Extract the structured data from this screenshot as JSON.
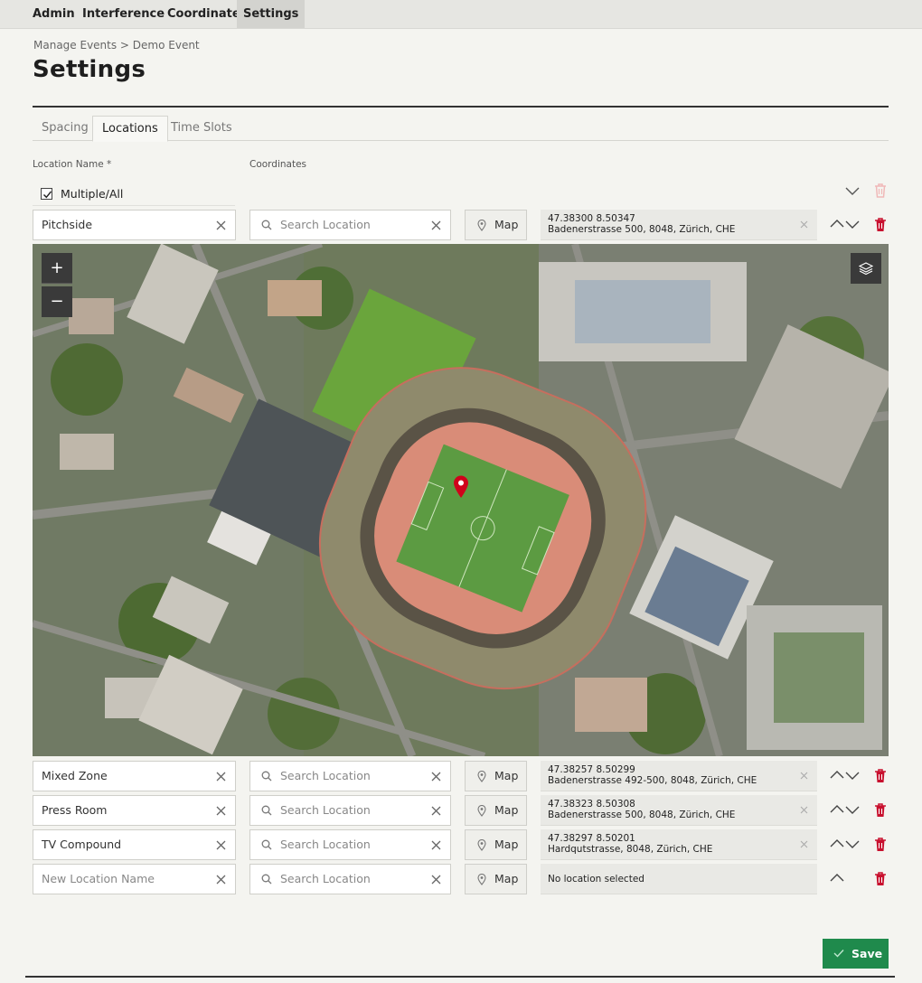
{
  "nav": {
    "items": [
      {
        "label": "Admin"
      },
      {
        "label": "Interference"
      },
      {
        "label": "Coordinate"
      },
      {
        "label": "Settings"
      }
    ]
  },
  "breadcrumb": "Manage Events > Demo Event",
  "title": "Settings",
  "tabs": [
    {
      "label": "Spacing"
    },
    {
      "label": "Locations"
    },
    {
      "label": "Time Slots"
    }
  ],
  "active_tab": "Locations",
  "columns": {
    "location_name": "Location Name *",
    "coordinates": "Coordinates"
  },
  "multiple": {
    "label": "Multiple/All",
    "checked": true
  },
  "search_placeholder": "Search Location",
  "map_button_label": "Map",
  "locations": [
    {
      "name": "Pitchside",
      "coords": "47.38300 8.50347",
      "address": "Badenerstrasse 500, 8048, Zürich, CHE"
    },
    {
      "name": "Mixed Zone",
      "coords": "47.38257 8.50299",
      "address": "Badenerstrasse 492-500, 8048, Zürich, CHE"
    },
    {
      "name": "Press Room",
      "coords": "47.38323 8.50308",
      "address": "Badenerstrasse 500, 8048, Zürich, CHE"
    },
    {
      "name": "TV Compound",
      "coords": "47.38297 8.50201",
      "address": "Hardqutstrasse, 8048, Zürich, CHE"
    }
  ],
  "new_location": {
    "placeholder": "New Location Name",
    "status": "No location selected"
  },
  "map": {
    "zoom_in": "+",
    "zoom_out": "−"
  },
  "save_label": "Save",
  "colors": {
    "accent_green": "#1f8a4c",
    "delete_red": "#c8102e",
    "marker_red": "#d0021b"
  }
}
